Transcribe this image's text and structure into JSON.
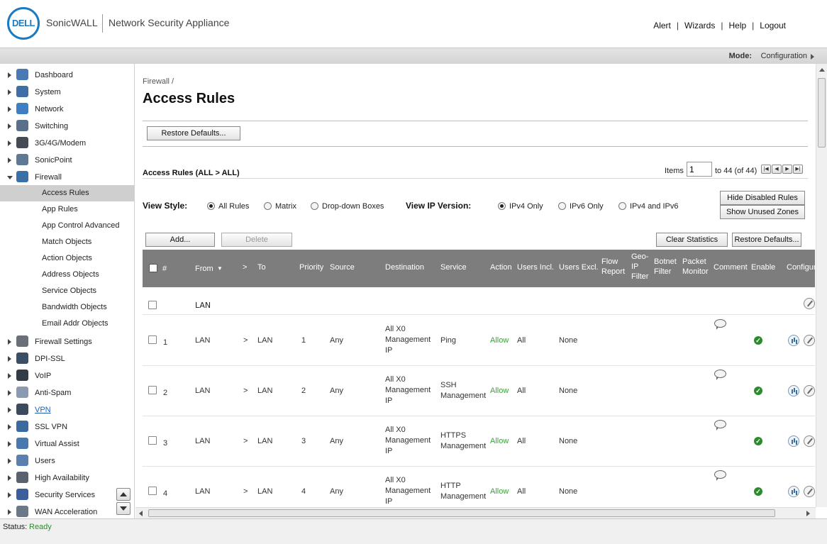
{
  "header": {
    "logo_text": "DELL",
    "brand": "SonicWALL",
    "product": "Network Security Appliance",
    "links": [
      "Alert",
      "Wizards",
      "Help",
      "Logout"
    ]
  },
  "modebar": {
    "label": "Mode:",
    "value": "Configuration"
  },
  "sidebar": {
    "items": [
      {
        "label": "Dashboard",
        "icon": "dashboard-icon",
        "color": "#4a7ab5"
      },
      {
        "label": "System",
        "icon": "monitor-icon",
        "color": "#3f6fa8"
      },
      {
        "label": "Network",
        "icon": "globe-icon",
        "color": "#3d7ec4"
      },
      {
        "label": "Switching",
        "icon": "switch-arrows-icon",
        "color": "#5a6f8a"
      },
      {
        "label": "3G/4G/Modem",
        "icon": "modem-icon",
        "color": "#444b56"
      },
      {
        "label": "SonicPoint",
        "icon": "access-point-icon",
        "color": "#5f7894"
      },
      {
        "label": "Firewall",
        "icon": "firewall-globe-icon",
        "color": "#3b6fa8"
      }
    ],
    "firewall_subitems": [
      "Access Rules",
      "App Rules",
      "App Control Advanced",
      "Match Objects",
      "Action Objects",
      "Address Objects",
      "Service Objects",
      "Bandwidth Objects",
      "Email Addr Objects"
    ],
    "items_after": [
      {
        "label": "Firewall Settings",
        "icon": "gears-icon",
        "color": "#6a6f78"
      },
      {
        "label": "DPI-SSL",
        "icon": "lock-icon",
        "color": "#3c4d66"
      },
      {
        "label": "VoIP",
        "icon": "headset-icon",
        "color": "#333b45"
      },
      {
        "label": "Anti-Spam",
        "icon": "mail-icon",
        "color": "#8a9bb0"
      },
      {
        "label": "VPN",
        "icon": "padlock-icon",
        "color": "#3b4a5e"
      },
      {
        "label": "SSL VPN",
        "icon": "ssl-vpn-icon",
        "color": "#3a6aa0"
      },
      {
        "label": "Virtual Assist",
        "icon": "assist-user-icon",
        "color": "#4a78b0"
      },
      {
        "label": "Users",
        "icon": "users-icon",
        "color": "#5b7fae"
      },
      {
        "label": "High Availability",
        "icon": "servers-icon",
        "color": "#5a6270"
      },
      {
        "label": "Security Services",
        "icon": "shield-icon",
        "color": "#3a5f9a"
      },
      {
        "label": "WAN Acceleration",
        "icon": "document-icon",
        "color": "#6b7888"
      }
    ]
  },
  "main": {
    "breadcrumb": "Firewall /",
    "title": "Access Rules",
    "restore_defaults_top": "Restore Defaults...",
    "section_title": "Access Rules (ALL > ALL)",
    "pager": {
      "items_label": "Items",
      "page": "1",
      "range": "to 44 (of 44)"
    },
    "view_style": {
      "label": "View Style:",
      "options": [
        "All Rules",
        "Matrix",
        "Drop-down Boxes"
      ],
      "selected": "All Rules"
    },
    "view_ip": {
      "label": "View IP Version:",
      "options": [
        "IPv4 Only",
        "IPv6 Only",
        "IPv4 and IPv6"
      ],
      "selected": "IPv4 Only"
    },
    "hide_disabled": "Hide Disabled Rules",
    "show_unused": "Show Unused Zones",
    "add": "Add...",
    "delete": "Delete",
    "clear_stats": "Clear Statistics",
    "restore_defaults": "Restore Defaults..."
  },
  "table": {
    "columns": {
      "num": "#",
      "from": "From",
      "arrow": ">",
      "to": "To",
      "priority": "Priority",
      "source": "Source",
      "destination": "Destination",
      "service": "Service",
      "action": "Action",
      "users_incl": "Users Incl.",
      "users_excl": "Users Excl.",
      "flow_report": "Flow Report",
      "geo_ip": "Geo-IP Filter",
      "botnet": "Botnet Filter",
      "packet_monitor": "Packet Monitor",
      "comment": "Comment",
      "enable": "Enable",
      "configure": "Configure"
    },
    "group": "LAN",
    "rows": [
      {
        "num": "1",
        "from": "LAN",
        "arrow": ">",
        "to": "LAN",
        "priority": "1",
        "source": "Any",
        "destination": "All X0 Management IP",
        "service": "Ping",
        "action": "Allow",
        "users_incl": "All",
        "users_excl": "None"
      },
      {
        "num": "2",
        "from": "LAN",
        "arrow": ">",
        "to": "LAN",
        "priority": "2",
        "source": "Any",
        "destination": "All X0 Management IP",
        "service": "SSH Management",
        "action": "Allow",
        "users_incl": "All",
        "users_excl": "None"
      },
      {
        "num": "3",
        "from": "LAN",
        "arrow": ">",
        "to": "LAN",
        "priority": "3",
        "source": "Any",
        "destination": "All X0 Management IP",
        "service": "HTTPS Management",
        "action": "Allow",
        "users_incl": "All",
        "users_excl": "None"
      },
      {
        "num": "4",
        "from": "LAN",
        "arrow": ">",
        "to": "LAN",
        "priority": "4",
        "source": "Any",
        "destination": "All X0 Management IP",
        "service": "HTTP Management",
        "action": "Allow",
        "users_incl": "All",
        "users_excl": "None"
      }
    ]
  },
  "status": {
    "label": "Status:",
    "value": "Ready"
  }
}
